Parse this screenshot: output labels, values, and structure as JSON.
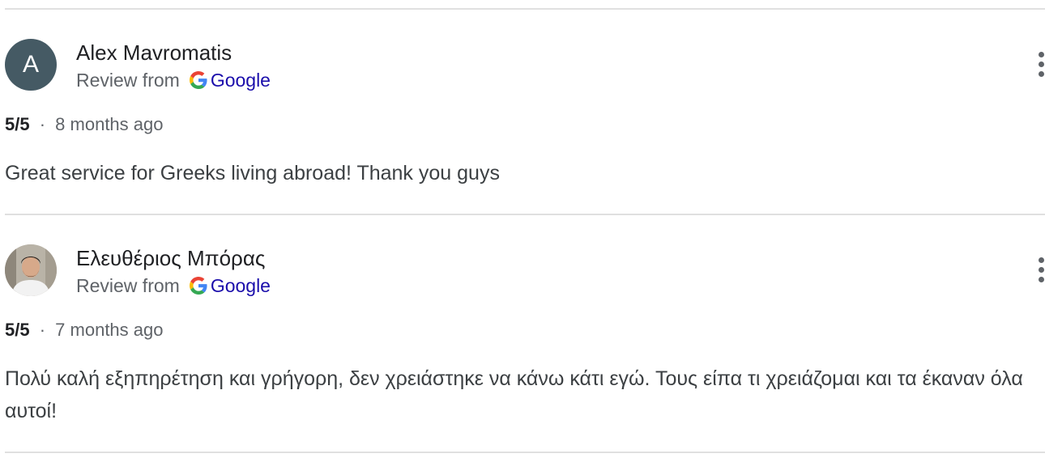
{
  "reviews": [
    {
      "author": "Alex Mavromatis",
      "avatar_letter": "A",
      "avatar_color": "#455a64",
      "source_prefix": "Review from",
      "source_name": "Google",
      "rating": "5/5",
      "separator": "·",
      "time_ago": "8 months ago",
      "text": "Great service for Greeks living abroad! Thank you guys"
    },
    {
      "author": "Ελευθέριος Μπόρας",
      "avatar_type": "photo",
      "source_prefix": "Review from",
      "source_name": "Google",
      "rating": "5/5",
      "separator": "·",
      "time_ago": "7 months ago",
      "text": "Πολύ καλή εξηπηρέτηση και γρήγορη, δεν χρειάστηκε να κάνω κάτι εγώ. Τους είπα τι χρειάζομαι και τα έκαναν όλα αυτοί!"
    }
  ],
  "icons": {
    "source_logo": "google-g-icon",
    "more_menu": "more-vert-icon"
  },
  "colors": {
    "link": "#1a0dab",
    "divider": "#e0e0e0",
    "secondary_text": "#5f6368"
  }
}
